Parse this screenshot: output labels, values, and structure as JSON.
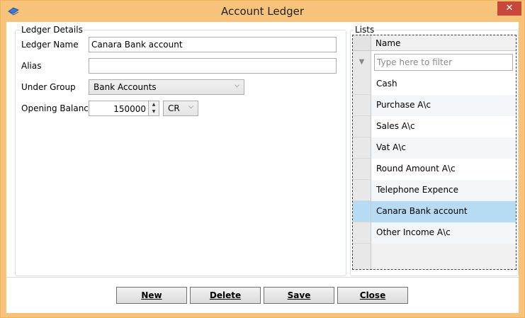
{
  "window": {
    "title": "Account Ledger",
    "close_glyph": "✕"
  },
  "ledger_details": {
    "legend": "Ledger Details",
    "ledger_name_label": "Ledger Name",
    "ledger_name_value": "Canara Bank account",
    "alias_label": "Alias",
    "alias_value": "",
    "under_group_label": "Under Group",
    "under_group_value": "Bank Accounts",
    "opening_balance_label": "Opening Balance",
    "opening_balance_value": "150000",
    "dr_cr_value": "CR"
  },
  "lists": {
    "legend": "Lists",
    "column_header": "Name",
    "filter_placeholder": "Type here to filter",
    "rows": [
      "Cash",
      "Purchase A\\c",
      "Sales A\\c",
      "Vat A\\c",
      "Round Amount A\\c",
      "Telephone Expence",
      "Canara Bank account",
      "Other Income A\\c"
    ],
    "selected_index": 6
  },
  "buttons": {
    "new": "New",
    "delete": "Delete",
    "save": "Save",
    "close": "Close"
  },
  "colors": {
    "title_bar": "#f7c27a",
    "selection": "#b7dbf3",
    "close": "#c8473b"
  }
}
